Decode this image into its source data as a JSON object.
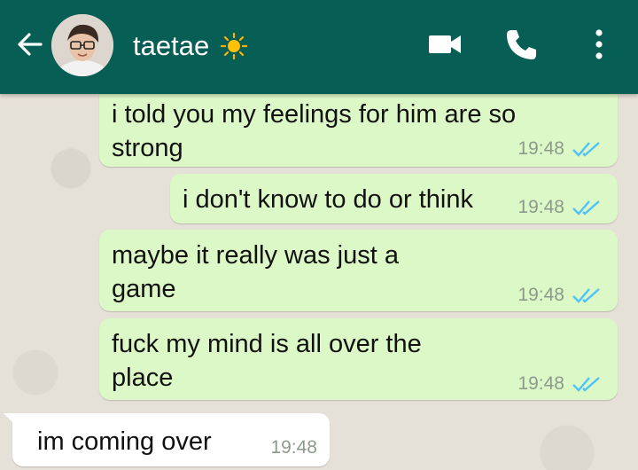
{
  "header": {
    "contact_name": "taetae",
    "colors": {
      "bar": "#075e54",
      "icons": "#ffffff"
    },
    "icons": [
      "arrow-back-icon",
      "contact-avatar",
      "sun-icon",
      "video-call-icon",
      "phone-call-icon",
      "overflow-menu-icon"
    ]
  },
  "messages": [
    {
      "text": "i told you my feelings for him are so\nstrong",
      "time": "19:48",
      "direction": "outgoing",
      "status": "read"
    },
    {
      "text": "i don't know to do or think",
      "time": "19:48",
      "direction": "outgoing",
      "status": "read"
    },
    {
      "text": "maybe it really was just a\ngame",
      "time": "19:48",
      "direction": "outgoing",
      "status": "read"
    },
    {
      "text": "fuck my mind is all over the\nplace",
      "time": "19:48",
      "direction": "outgoing",
      "status": "read"
    },
    {
      "text": "im coming over",
      "time": "19:48",
      "direction": "incoming"
    }
  ],
  "colors": {
    "outgoing_bubble": "#dcf8c6",
    "incoming_bubble": "#ffffff",
    "read_ticks": "#4fc3f7",
    "timestamp": "#8c9a8c"
  }
}
